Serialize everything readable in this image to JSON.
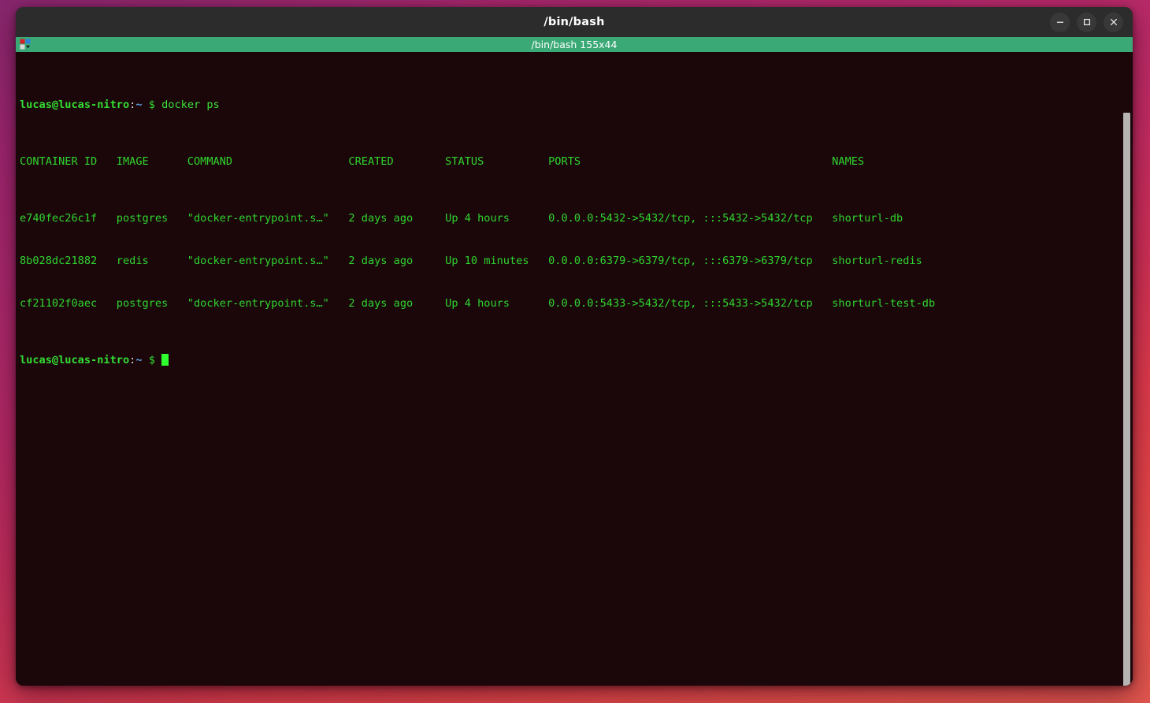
{
  "window": {
    "title": "/bin/bash",
    "controls": [
      {
        "name": "minimize",
        "label": "Minimize"
      },
      {
        "name": "maximize",
        "label": "Maximize"
      },
      {
        "name": "close",
        "label": "Close"
      }
    ]
  },
  "tab_bar": {
    "menu_icon": "tab-grid-icon",
    "active_tab_label": "/bin/bash 155x44"
  },
  "terminal": {
    "prompt": {
      "user_host": "lucas@lucas-nitro",
      "colon": ":",
      "path": "~",
      "symbol": "$"
    },
    "command": "docker ps",
    "table": {
      "headers": [
        "CONTAINER ID",
        "IMAGE",
        "COMMAND",
        "CREATED",
        "STATUS",
        "PORTS",
        "NAMES"
      ],
      "rows": [
        {
          "container_id": "e740fec26c1f",
          "image": "postgres",
          "command": "\"docker-entrypoint.s…\"",
          "created": "2 days ago",
          "status": "Up 4 hours",
          "ports": "0.0.0.0:5432->5432/tcp, :::5432->5432/tcp",
          "names": "shorturl-db"
        },
        {
          "container_id": "8b028dc21882",
          "image": "redis",
          "command": "\"docker-entrypoint.s…\"",
          "created": "2 days ago",
          "status": "Up 10 minutes",
          "ports": "0.0.0.0:6379->6379/tcp, :::6379->6379/tcp",
          "names": "shorturl-redis"
        },
        {
          "container_id": "cf21102f0aec",
          "image": "postgres",
          "command": "\"docker-entrypoint.s…\"",
          "created": "2 days ago",
          "status": "Up 4 hours",
          "ports": "0.0.0.0:5433->5432/tcp, :::5433->5432/tcp",
          "names": "shorturl-test-db"
        }
      ]
    },
    "lines": {
      "header_row": "CONTAINER ID   IMAGE      COMMAND                  CREATED        STATUS          PORTS                                       NAMES",
      "row_1": "e740fec26c1f   postgres   \"docker-entrypoint.s…\"   2 days ago     Up 4 hours      0.0.0.0:5432->5432/tcp, :::5432->5432/tcp   shorturl-db",
      "row_2": "8b028dc21882   redis      \"docker-entrypoint.s…\"   2 days ago     Up 10 minutes   0.0.0.0:6379->6379/tcp, :::6379->6379/tcp   shorturl-redis",
      "row_3": "cf21102f0aec   postgres   \"docker-entrypoint.s…\"   2 days ago     Up 4 hours      0.0.0.0:5433->5432/tcp, :::5433->5432/tcp   shorturl-test-db"
    }
  },
  "colors": {
    "tab_bar_green": "#3aa976",
    "title_bar": "#2c2c2c",
    "terminal_background": "#1b0609",
    "terminal_green": "#2fd62f",
    "prompt_path_blue": "#5c9fe0",
    "cursor_green": "#2eff2e",
    "scrollbar": "#b6b3b3",
    "desktop_gradient_top": "#8e2a6e",
    "desktop_gradient_bottom": "#e0564e"
  }
}
